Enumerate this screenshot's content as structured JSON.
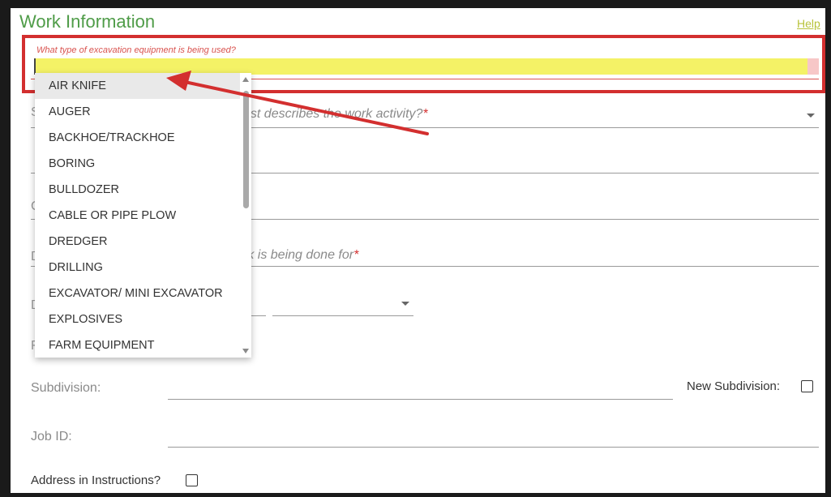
{
  "header": {
    "title": "Work Information",
    "help_link": "Help"
  },
  "equipment": {
    "question": "What type of excavation equipment is being used?",
    "value": "",
    "options": [
      "AIR KNIFE",
      "AUGER",
      "BACKHOE/TRACKHOE",
      "BORING",
      "BULLDOZER",
      "CABLE OR PIPE PLOW",
      "DREDGER",
      "DRILLING",
      "EXCAVATOR/ MINI EXCAVATOR",
      "EXPLOSIVES",
      "FARM EQUIPMENT"
    ],
    "selected_option": "AIR KNIFE"
  },
  "work_activity": {
    "label_fragment": "est describes the work activity?",
    "required_mark": "*",
    "cut_letter": "S"
  },
  "done_for": {
    "label_fragment": "rk is being done for",
    "required_mark": "*",
    "cut_letter": "D"
  },
  "hidden_rows": {
    "row_c_letter": "C",
    "row_d2_letter": "D",
    "row_f_letter": "F"
  },
  "subdivision": {
    "label": "Subdivision:",
    "value": "",
    "new_label": "New Subdivision:",
    "new_checked": false
  },
  "job_id": {
    "label": "Job ID:",
    "value": ""
  },
  "address": {
    "label": "Address in Instructions?",
    "checked": false
  },
  "colors": {
    "title_green": "#4f9c48",
    "annotation_red": "#d32f2f",
    "input_highlight": "#f4f266"
  }
}
